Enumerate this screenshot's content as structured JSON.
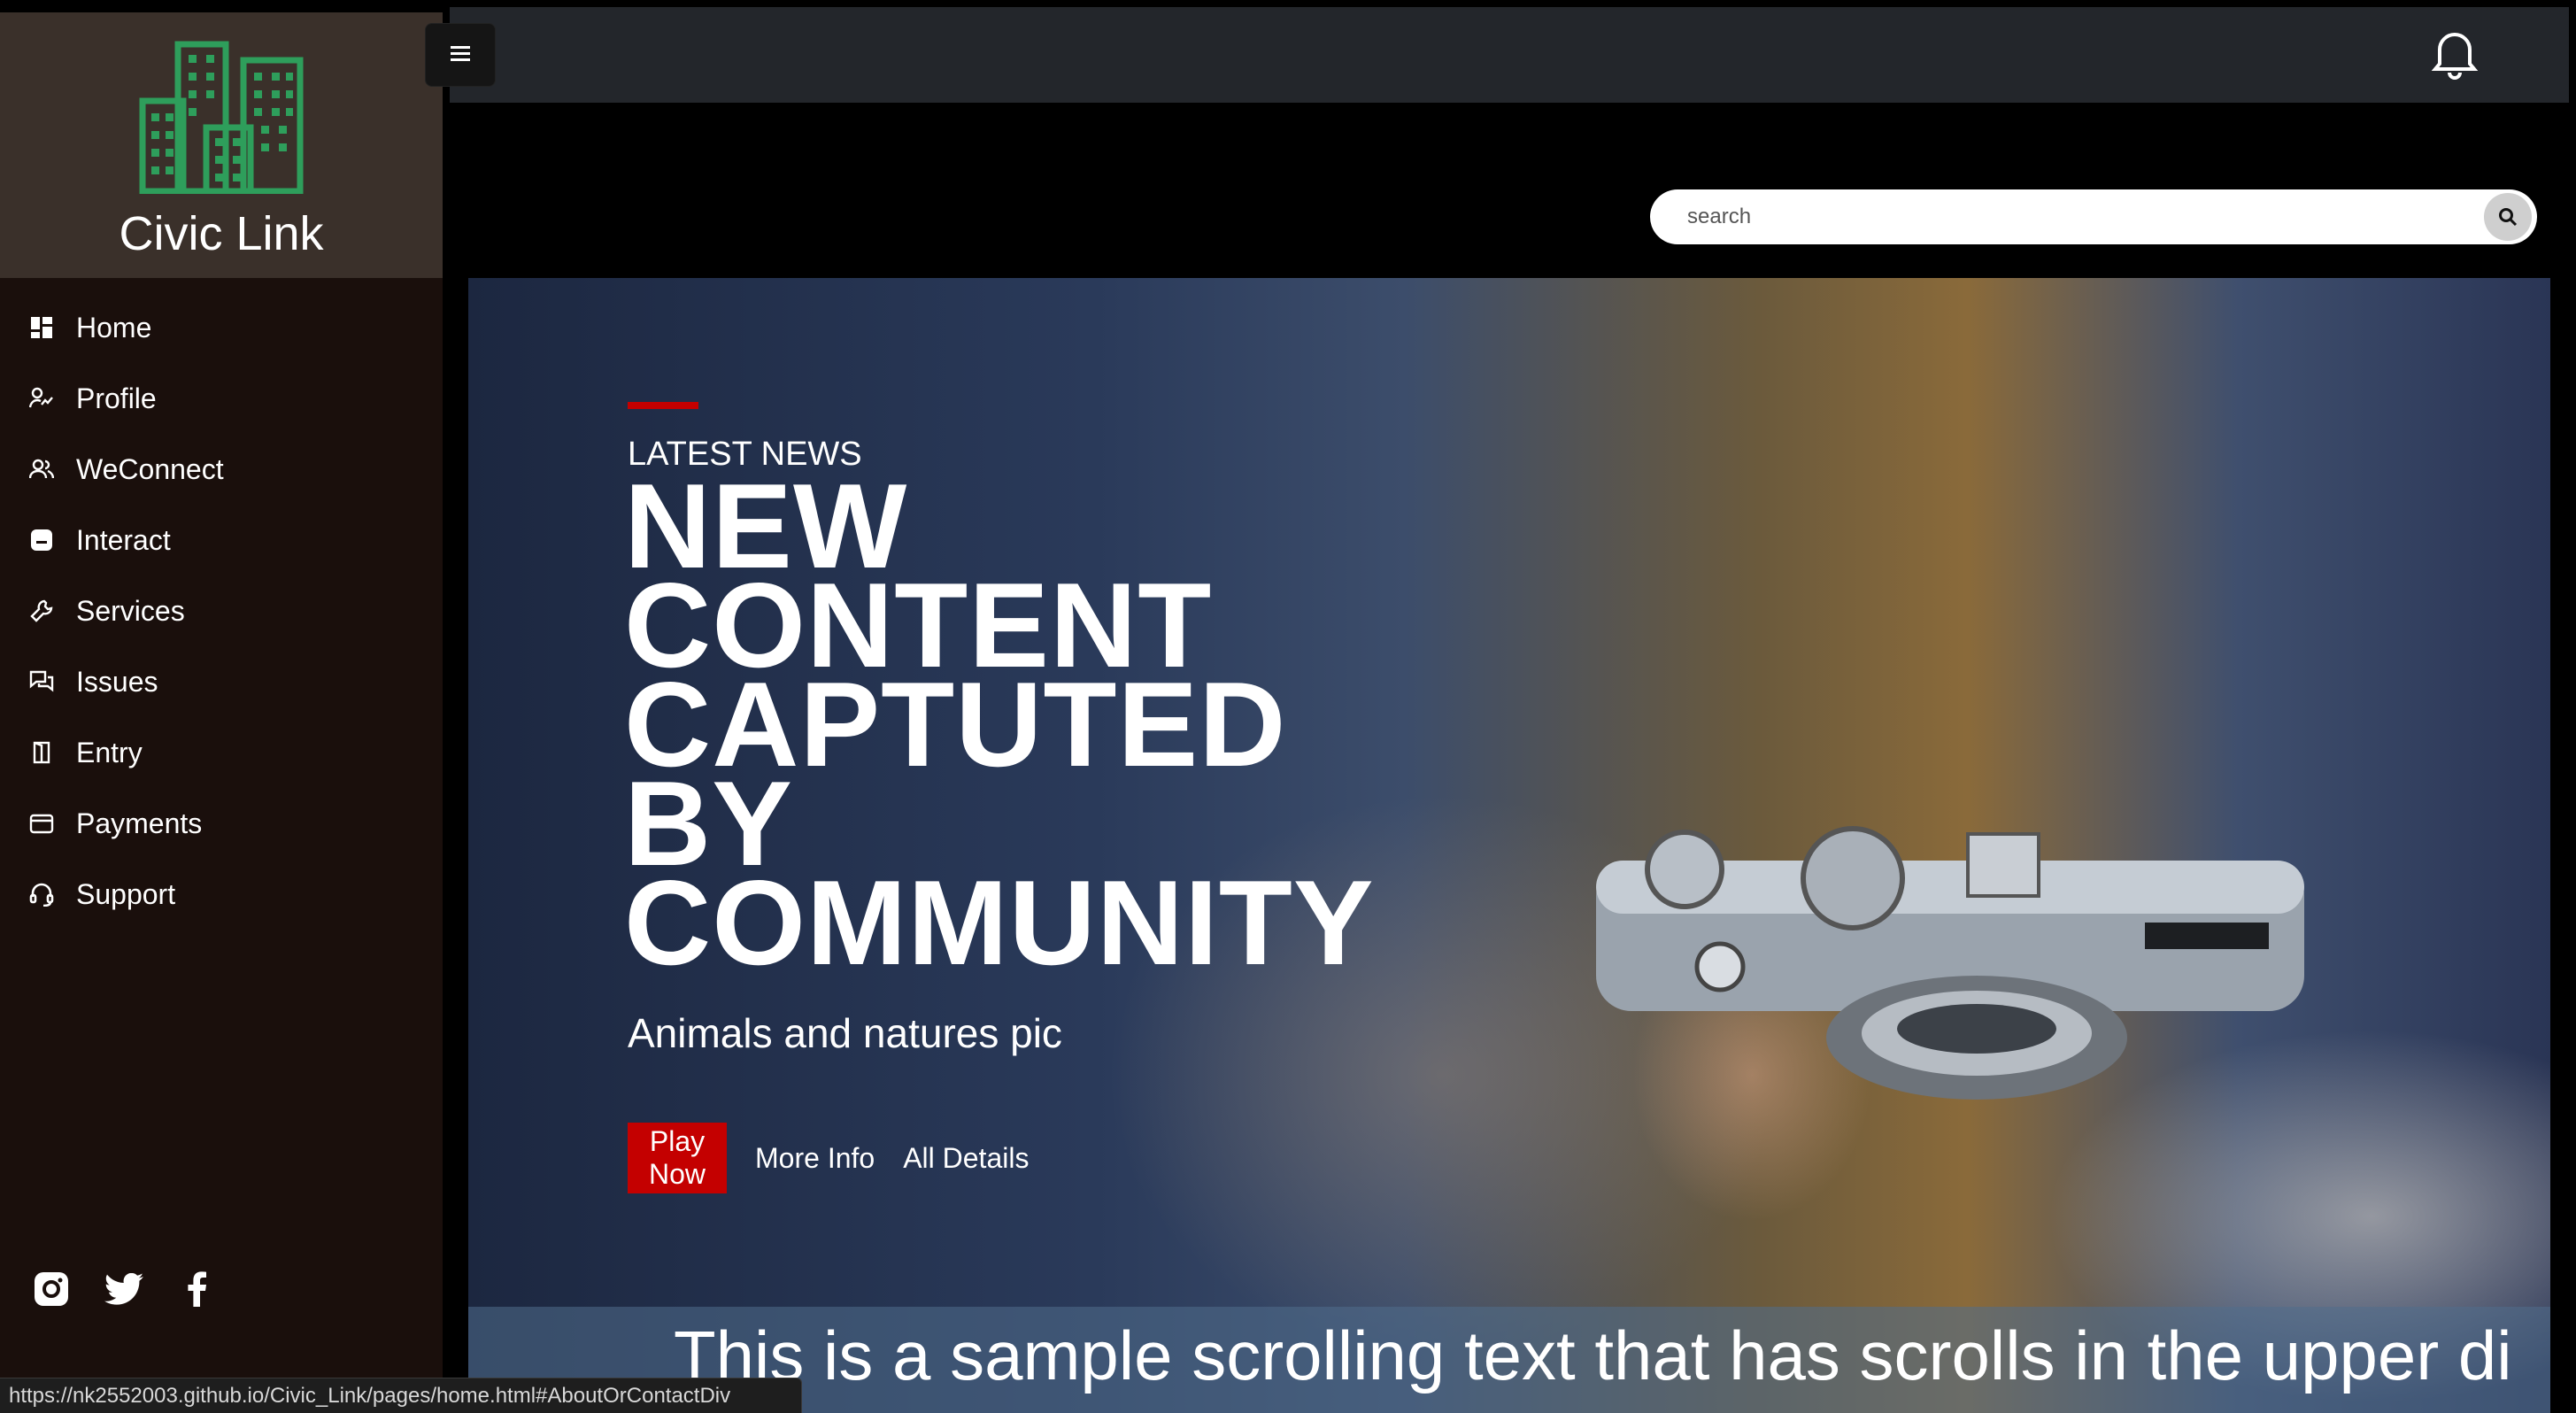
{
  "brand": {
    "name": "Civic Link",
    "logo_icon": "city-buildings-icon",
    "accent": "#2e9e5b"
  },
  "sidebar": {
    "items": [
      {
        "label": "Home",
        "icon": "dashboard-icon"
      },
      {
        "label": "Profile",
        "icon": "user-activity-icon"
      },
      {
        "label": "WeConnect",
        "icon": "people-icon"
      },
      {
        "label": "Interact",
        "icon": "chat-bubble-icon"
      },
      {
        "label": "Services",
        "icon": "wrench-icon"
      },
      {
        "label": "Issues",
        "icon": "comments-icon"
      },
      {
        "label": "Entry",
        "icon": "door-icon"
      },
      {
        "label": "Payments",
        "icon": "wallet-icon"
      },
      {
        "label": "Support",
        "icon": "headset-icon"
      }
    ],
    "socials": [
      "instagram-icon",
      "twitter-icon",
      "facebook-icon"
    ]
  },
  "header": {
    "menu_icon": "hamburger-icon",
    "notification_icon": "bell-icon"
  },
  "search": {
    "placeholder": "search",
    "value": ""
  },
  "hero": {
    "eyebrow": "LATEST NEWS",
    "headline": [
      "NEW",
      "CONTENT",
      "CAPTUTED",
      "BY",
      "COMMUNITY"
    ],
    "subtitle": "Animals and natures pic",
    "primary_cta": "Play Now",
    "secondary_links": [
      "More Info",
      "All Details"
    ],
    "accent": "#c40000"
  },
  "ticker": {
    "text": "This is a sample scrolling text that has scrolls in the upper di"
  },
  "status_bar": {
    "url": "https://nk2552003.github.io/Civic_Link/pages/home.html#AboutOrContactDiv"
  }
}
